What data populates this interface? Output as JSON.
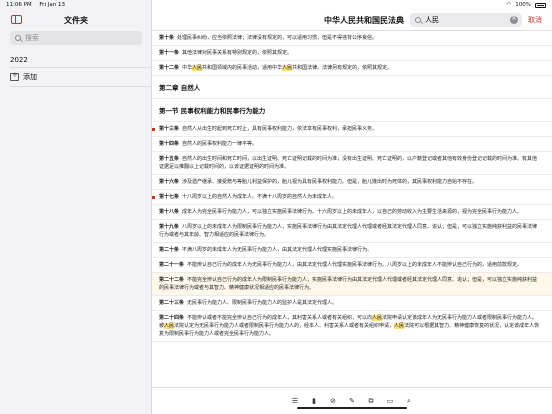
{
  "status": {
    "time": "11:06 PM",
    "date": "Fri Jan 13",
    "battery": "100%"
  },
  "sidebar": {
    "title": "文件夹",
    "search_placeholder": "搜索",
    "folders": [
      "2022"
    ],
    "add_label": "添加"
  },
  "document": {
    "title": "中华人民共和国民法典",
    "search_value": "人民",
    "cancel_label": "取消"
  },
  "articles": [
    {
      "text": "第十条 处理民事纠纷，应当依照法律；法律没有规定的，可以适用习惯，但是不得违背公序良俗。",
      "marked": false,
      "highlight": false
    },
    {
      "text": "第十一条 其他法律对民事关系有特别规定的，依照其规定。",
      "marked": false,
      "highlight": false
    },
    {
      "text": "第十二条 中华人民共和国领域内的民事活动，适用中华人民共和国法律。法律另有规定的，依照其规定。",
      "marked": false,
      "highlight": false
    },
    {
      "heading": "第二章 自然人"
    },
    {
      "heading": "第一节 民事权利能力和民事行为能力"
    },
    {
      "text": "第十三条 自然人从出生时起到死亡时止，具有民事权利能力，依法享有民事权利，承担民事义务。",
      "marked": true,
      "highlight": false
    },
    {
      "text": "第十四条 自然人的民事权利能力一律平等。",
      "marked": false,
      "highlight": false
    },
    {
      "text": "第十五条 自然人的出生时间和死亡时间，以出生证明、死亡证明记载的时间为准；没有出生证明、死亡证明的，以户籍登记或者其他有效身份登记记载的时间为准。有其他证据足以推翻以上记载时间的，以该证据证明的时间为准。",
      "marked": false,
      "highlight": false
    },
    {
      "text": "第十六条 涉及遗产继承、接受赠与等胎儿利益保护的，胎儿视为具有民事权利能力。但是，胎儿娩出时为死体的，其民事权利能力自始不存在。",
      "marked": false,
      "highlight": false
    },
    {
      "text": "第十七条 十八周岁以上的自然人为成年人。不满十八周岁的自然人为未成年人。",
      "marked": true,
      "highlight": false
    },
    {
      "text": "第十八条 成年人为完全民事行为能力人，可以独立实施民事法律行为。十六周岁以上的未成年人，以自己的劳动收入为主要生活来源的，视为完全民事行为能力人。",
      "marked": false,
      "highlight": false
    },
    {
      "text": "第十九条 八周岁以上的未成年人为限制民事行为能力人，实施民事法律行为由其法定代理人代理或者经其法定代理人同意、追认；但是，可以独立实施纯获利益的民事法律行为或者与其年龄、智力相适应的民事法律行为。",
      "marked": false,
      "highlight": false
    },
    {
      "text": "第二十条 不满八周岁的未成年人为无民事行为能力人，由其法定代理人代理实施民事法律行为。",
      "marked": false,
      "highlight": false
    },
    {
      "text": "第二十一条 不能辨认自己行为的成年人为无民事行为能力人，由其法定代理人代理实施民事法律行为。八周岁以上的未成年人不能辨认自己行为的，适用前款规定。",
      "marked": false,
      "highlight": false
    },
    {
      "text": "第二十二条 不能完全辨认自己行为的成年人为限制民事行为能力人，实施民事法律行为由其法定代理人代理或者经其法定代理人同意、追认；但是，可以独立实施纯获利益的民事法律行为或者与其智力、精神健康状况相适应的民事法律行为。",
      "marked": false,
      "highlight": true
    },
    {
      "text": "第二十三条 无民事行为能力人、限制民事行为能力人的监护人是其法定代理人。",
      "marked": false,
      "highlight": false
    },
    {
      "text": "第二十四条 不能辨认或者不能完全辨认自己行为的成年人，其利害关系人或者有关组织，可以向人民法院申请认定该成年人为无民事行为能力人或者限制民事行为能力人。被人民法院认定为无民事行为能力人或者限制民事行为能力人的，经本人、利害关系人或者有关组织申请，人民法院可以根据其智力、精神健康恢复的状况，认定该成年人恢复为限制民事行为能力人或者完全民事行为能力人。",
      "marked": false,
      "highlight": false
    }
  ],
  "highlight_term": "人民",
  "accent_color": "#c0392b",
  "toolbar_icons": [
    "list-icon",
    "bookmark-icon",
    "link-icon",
    "edit-icon",
    "copy-icon",
    "book-icon",
    "search-icon"
  ]
}
